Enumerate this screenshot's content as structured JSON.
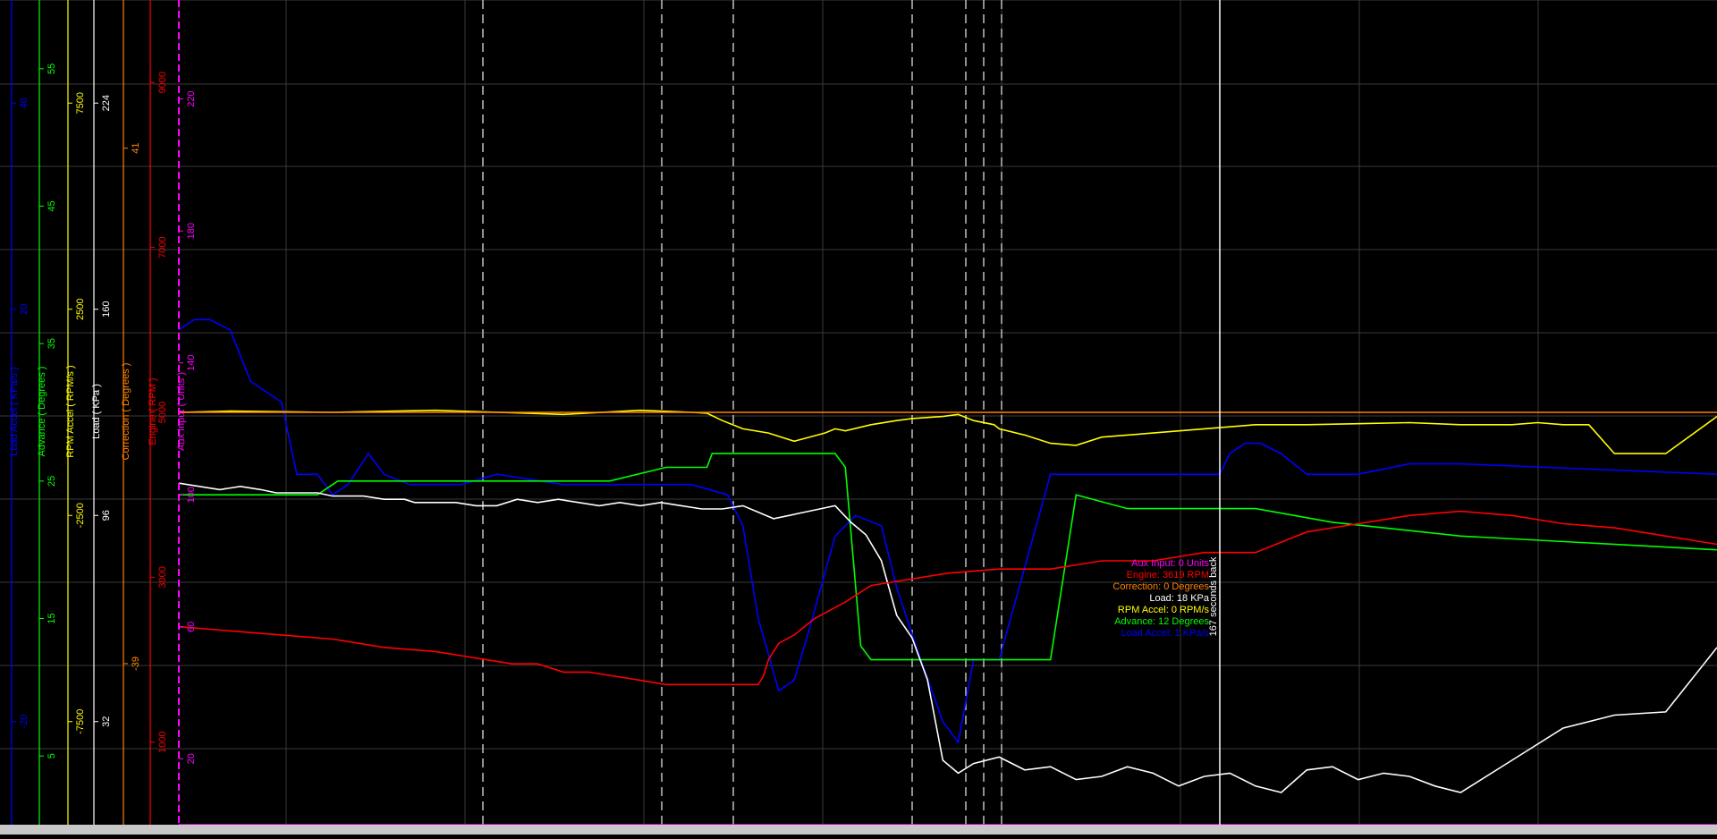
{
  "chart_data": {
    "type": "line",
    "grid": true,
    "duration_seconds": 300,
    "time_axis_direction": "right is oldest",
    "axes": [
      {
        "id": "loadaccel",
        "label": "Load Accel ( KPa/s )",
        "color": "#0000ff",
        "ylim": [
          -30,
          50
        ],
        "ticks": [
          {
            "v": 40,
            "t": "40"
          },
          {
            "v": 20,
            "t": "20"
          },
          {
            "v": -20,
            "t": "-20"
          }
        ]
      },
      {
        "id": "advance",
        "label": "Advance ( Degrees )",
        "color": "#00ff00",
        "ylim": [
          0,
          60
        ],
        "ticks": [
          {
            "v": 55,
            "t": "55"
          },
          {
            "v": 45,
            "t": "45"
          },
          {
            "v": 35,
            "t": "35"
          },
          {
            "v": 25,
            "t": "25"
          },
          {
            "v": 15,
            "t": "15"
          },
          {
            "v": 5,
            "t": "5"
          }
        ]
      },
      {
        "id": "rpmaccel",
        "label": "RPM Accel ( RPM/s )",
        "color": "#ffff00",
        "ylim": [
          -10000,
          10000
        ],
        "ticks": [
          {
            "v": 7500,
            "t": "7500"
          },
          {
            "v": 2500,
            "t": "2500"
          },
          {
            "v": -2500,
            "t": "-2500"
          },
          {
            "v": -7500,
            "t": "-7500"
          }
        ]
      },
      {
        "id": "load",
        "label": "Load ( KPa )",
        "color": "#ffffff",
        "ylim": [
          0,
          256
        ],
        "ticks": [
          {
            "v": 224,
            "t": "224"
          },
          {
            "v": 160,
            "t": "160"
          },
          {
            "v": 96,
            "t": "96"
          },
          {
            "v": 32,
            "t": "32"
          }
        ]
      },
      {
        "id": "correction",
        "label": "Correction ( Degrees )",
        "color": "#ff8000",
        "ylim": [
          -64,
          64
        ],
        "ticks": [
          {
            "v": 41,
            "t": "41"
          },
          {
            "v": -39,
            "t": "-39"
          }
        ]
      },
      {
        "id": "engine",
        "label": "Engine ( RPM )",
        "color": "#ff0000",
        "ylim": [
          0,
          10000
        ],
        "ticks": [
          {
            "v": 9000,
            "t": "9000"
          },
          {
            "v": 7000,
            "t": "7000"
          },
          {
            "v": 5000,
            "t": "5000"
          },
          {
            "v": 3000,
            "t": "3000"
          },
          {
            "v": 1000,
            "t": "1000"
          }
        ]
      },
      {
        "id": "aux",
        "label": "Aux Input ( Units )",
        "color": "#ff00ff",
        "ylim": [
          0,
          250
        ],
        "ticks": [
          {
            "v": 220,
            "t": "220"
          },
          {
            "v": 180,
            "t": "180"
          },
          {
            "v": 140,
            "t": "140"
          },
          {
            "v": 100,
            "t": "100"
          },
          {
            "v": 60,
            "t": "60"
          },
          {
            "v": 20,
            "t": "20"
          }
        ]
      }
    ],
    "series": [
      {
        "name": "Load Accel",
        "axis": "loadaccel",
        "color": "#0000ff",
        "x": [
          0,
          3,
          6,
          10,
          14,
          20,
          23,
          27,
          30,
          33,
          37,
          40,
          45,
          50,
          55,
          62,
          75,
          90,
          100,
          107,
          110,
          113,
          117,
          120,
          123,
          128,
          132,
          137,
          140,
          144,
          149,
          152,
          155,
          160,
          165,
          170,
          175,
          180,
          190,
          200,
          203,
          205,
          208,
          211,
          215,
          220,
          230,
          240,
          250,
          300
        ],
        "y": [
          18,
          19,
          19,
          18,
          13,
          11,
          4,
          4,
          2,
          3,
          6,
          4,
          3,
          3,
          3,
          4,
          3,
          3,
          3,
          2,
          -1,
          -10,
          -17,
          -16,
          -11,
          -2,
          0,
          -1,
          -7,
          -13,
          -20,
          -22,
          -14,
          -14,
          -5,
          4,
          4,
          4,
          4,
          4,
          4,
          6,
          7,
          7,
          6,
          4,
          4,
          5,
          5,
          4
        ]
      },
      {
        "name": "Advance",
        "axis": "advance",
        "color": "#00ff00",
        "x": [
          0,
          27,
          31,
          50,
          75,
          84,
          95,
          100,
          103,
          104,
          106,
          126,
          128,
          130,
          133,
          135,
          140,
          150,
          160,
          170,
          175,
          185,
          210,
          225,
          250,
          300
        ],
        "y": [
          24,
          24,
          25,
          25,
          25,
          25,
          26,
          26,
          26,
          27,
          27,
          27,
          27,
          26,
          13,
          12,
          12,
          12,
          12,
          12,
          24,
          23,
          23,
          22,
          21,
          20
        ]
      },
      {
        "name": "RPM Accel",
        "axis": "rpmaccel",
        "color": "#ffff00",
        "x": [
          0,
          10,
          30,
          50,
          75,
          90,
          100,
          103,
          106,
          110,
          115,
          120,
          126,
          128,
          130,
          135,
          140,
          143,
          149,
          152,
          155,
          159,
          160,
          165,
          170,
          175,
          180,
          190,
          200,
          210,
          220,
          240,
          250,
          255,
          260,
          265,
          270,
          275,
          280,
          290,
          300
        ],
        "y": [
          0,
          30,
          0,
          50,
          -50,
          50,
          0,
          -20,
          -200,
          -400,
          -500,
          -700,
          -500,
          -400,
          -450,
          -300,
          -200,
          -150,
          -100,
          -50,
          -200,
          -300,
          -400,
          -550,
          -750,
          -800,
          -600,
          -500,
          -400,
          -300,
          -300,
          -250,
          -300,
          -300,
          -300,
          -250,
          -300,
          -300,
          -1000,
          -1000,
          -100
        ]
      },
      {
        "name": "Load",
        "axis": "load",
        "color": "#ffffff",
        "x": [
          0,
          4,
          8,
          12,
          16,
          19,
          22,
          27,
          30,
          33,
          36,
          40,
          44,
          46,
          50,
          54,
          58,
          62,
          66,
          70,
          74,
          78,
          82,
          86,
          90,
          94,
          98,
          102,
          106,
          110,
          113,
          116,
          119,
          122,
          125,
          128,
          131,
          134,
          137,
          140,
          143,
          146,
          149,
          152,
          155,
          160,
          165,
          170,
          175,
          180,
          185,
          190,
          195,
          200,
          205,
          210,
          215,
          220,
          225,
          230,
          235,
          240,
          245,
          250,
          260,
          270,
          280,
          290,
          300
        ],
        "y": [
          106,
          105,
          104,
          105,
          104,
          103,
          103,
          103,
          102,
          102,
          102,
          101,
          101,
          100,
          100,
          100,
          99,
          99,
          101,
          100,
          101,
          100,
          99,
          100,
          99,
          100,
          99,
          98,
          98,
          99,
          97,
          95,
          96,
          97,
          98,
          99,
          94,
          90,
          82,
          65,
          58,
          45,
          20,
          16,
          19,
          21,
          17,
          18,
          14,
          15,
          18,
          16,
          12,
          15,
          16,
          12,
          10,
          17,
          18,
          14,
          16,
          15,
          12,
          10,
          20,
          30,
          34,
          35,
          55
        ]
      },
      {
        "name": "Correction",
        "axis": "correction",
        "color": "#ff8000",
        "x": [
          0,
          300
        ],
        "y": [
          0,
          0
        ]
      },
      {
        "name": "Engine",
        "axis": "engine",
        "color": "#ff0000",
        "x": [
          0,
          10,
          20,
          30,
          40,
          50,
          55,
          60,
          65,
          70,
          75,
          80,
          85,
          90,
          95,
          100,
          103,
          105,
          108,
          110,
          113,
          114,
          115,
          117,
          120,
          124,
          130,
          135,
          140,
          150,
          160,
          170,
          180,
          190,
          200,
          210,
          220,
          230,
          240,
          250,
          260,
          270,
          280,
          290,
          300
        ],
        "y": [
          2400,
          2350,
          2300,
          2250,
          2150,
          2100,
          2050,
          2000,
          1950,
          1950,
          1850,
          1850,
          1800,
          1750,
          1700,
          1700,
          1700,
          1700,
          1700,
          1700,
          1700,
          1800,
          2000,
          2200,
          2300,
          2500,
          2700,
          2900,
          2950,
          3050,
          3100,
          3100,
          3200,
          3200,
          3300,
          3300,
          3550,
          3650,
          3750,
          3800,
          3750,
          3650,
          3600,
          3500,
          3400
        ]
      },
      {
        "name": "Aux Input",
        "axis": "aux",
        "color": "#ff00ff",
        "x": [
          0,
          300
        ],
        "y": [
          0,
          0
        ]
      }
    ],
    "cursor": {
      "time": "167 seconds back",
      "readout": [
        {
          "label": "Aux Input: 0 Units",
          "color": "#ff00ff"
        },
        {
          "label": "Engine: 3619 RPM",
          "color": "#ff0000"
        },
        {
          "label": "Correction: 0 Degrees",
          "color": "#ff8000"
        },
        {
          "label": "Load: 18 KPa",
          "color": "#ffffff"
        },
        {
          "label": "RPM Accel: 0 RPM/s",
          "color": "#ffff00"
        },
        {
          "label": "Advance: 12 Degrees",
          "color": "#00ff00"
        },
        {
          "label": "Load Accel: 1 KPa/s",
          "color": "#0000ff"
        }
      ]
    }
  }
}
